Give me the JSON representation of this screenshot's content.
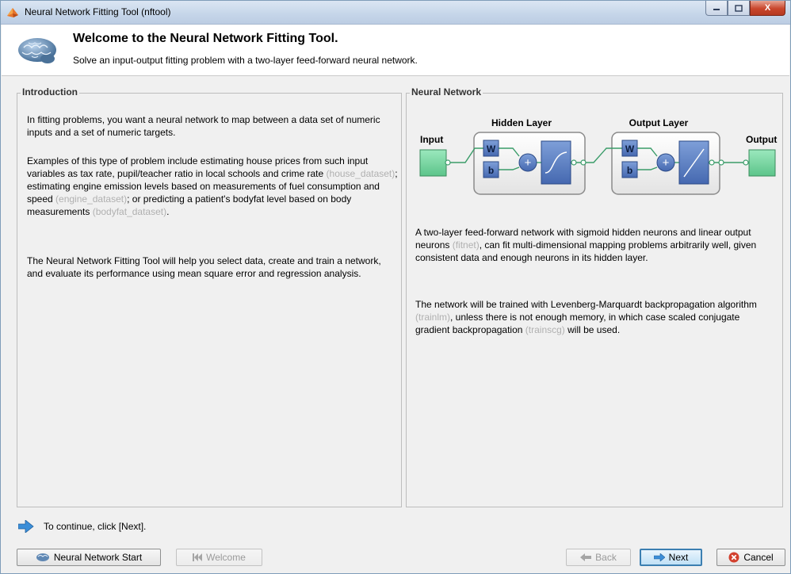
{
  "window": {
    "title": "Neural Network Fitting Tool (nftool)",
    "controls": [
      "minimize",
      "maximize",
      "close"
    ],
    "close_glyph": "X"
  },
  "header": {
    "title": "Welcome to the Neural Network Fitting Tool.",
    "subtitle": "Solve an input-output fitting problem with a two-layer feed-forward neural network."
  },
  "introduction": {
    "legend": "Introduction",
    "p1": "In fitting problems, you want a neural network to map between a data set of numeric inputs and a set of numeric targets.",
    "p2_a": "Examples of this type of problem include estimating house prices from such input variables as tax rate, pupil/teacher ratio in local schools and crime rate ",
    "p2_link1": "(house_dataset)",
    "p2_b": "; estimating engine emission levels based on measurements of fuel consumption and speed ",
    "p2_link2": "(engine_dataset)",
    "p2_c": "; or predicting a patient's bodyfat level based on body measurements ",
    "p2_link3": "(bodyfat_dataset)",
    "p2_d": ".",
    "p3": "The Neural Network Fitting Tool will help you select data, create and train a network, and evaluate its performance using mean square error and regression analysis."
  },
  "neural_network": {
    "legend": "Neural Network",
    "diagram": {
      "input_label": "Input",
      "hidden_label": "Hidden Layer",
      "output_layer_label": "Output Layer",
      "output_label": "Output",
      "weight_label": "W",
      "bias_label": "b",
      "sum_glyph": "+"
    },
    "p1_a": "A two-layer feed-forward network with sigmoid hidden neurons and linear output neurons ",
    "p1_link": "(fitnet)",
    "p1_b": ", can fit multi-dimensional mapping problems arbitrarily well, given consistent data and enough neurons in its hidden layer.",
    "p2_a": "The network will be trained with Levenberg-Marquardt backpropagation algorithm ",
    "p2_link1": "(trainlm)",
    "p2_b": ", unless there is not enough memory, in which case scaled conjugate gradient backpropagation ",
    "p2_link2": "(trainscg)",
    "p2_c": " will be used."
  },
  "footer": {
    "hint": "To continue, click [Next].",
    "buttons": {
      "start": "Neural Network Start",
      "welcome": "Welcome",
      "back": "Back",
      "next": "Next",
      "cancel": "Cancel"
    }
  },
  "colors": {
    "titlebar": "#c5d5e9",
    "layer_blue": "#5b7fc4",
    "node_green": "#76d6a0",
    "hint_arrow": "#3b8ed8",
    "cancel_red": "#d2402e"
  }
}
